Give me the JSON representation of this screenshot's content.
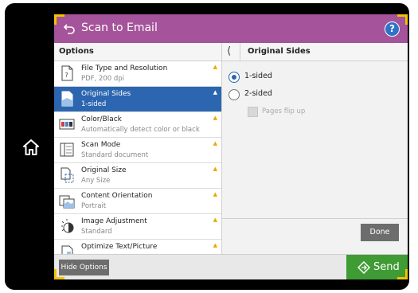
{
  "header": {
    "title": "Scan to Email",
    "help_glyph": "?"
  },
  "left_panel": {
    "header": "Options",
    "items": [
      {
        "label": "File Type and Resolution",
        "value": "PDF, 200 dpi",
        "icon": "file-type-icon",
        "selected": false
      },
      {
        "label": "Original Sides",
        "value": "1-sided",
        "icon": "original-sides-icon",
        "selected": true
      },
      {
        "label": "Color/Black",
        "value": "Automatically detect color or black",
        "icon": "color-black-icon",
        "selected": false
      },
      {
        "label": "Scan Mode",
        "value": "Standard document",
        "icon": "scan-mode-icon",
        "selected": false
      },
      {
        "label": "Original Size",
        "value": "Any Size",
        "icon": "original-size-icon",
        "selected": false
      },
      {
        "label": "Content Orientation",
        "value": "Portrait",
        "icon": "orientation-icon",
        "selected": false
      },
      {
        "label": "Image Adjustment",
        "value": "Standard",
        "icon": "image-adjustment-icon",
        "selected": false
      },
      {
        "label": "Optimize Text/Picture",
        "value": "",
        "icon": "optimize-icon",
        "selected": false
      }
    ]
  },
  "right_panel": {
    "header": "Original Sides",
    "options": [
      {
        "label": "1-sided",
        "selected": true
      },
      {
        "label": "2-sided",
        "selected": false
      }
    ],
    "checkbox_label": "Pages flip up",
    "done_label": "Done"
  },
  "bottom": {
    "hide_options_label": "Hide Options",
    "send_label": "Send"
  },
  "colors": {
    "header_bg": "#a5539a",
    "selected_row": "#2c66b0",
    "send_bg": "#3f9c35",
    "corner_accent": "#f3c200"
  }
}
